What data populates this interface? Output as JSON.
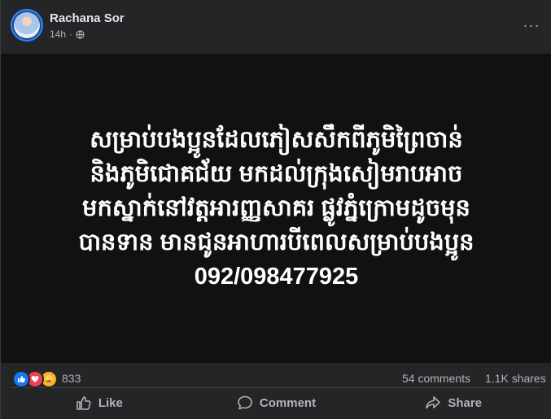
{
  "post": {
    "author": "Rachana Sor",
    "time": "14h",
    "separator": "·",
    "privacy_icon": "globe-icon",
    "more_icon": "more-options-icon",
    "more_glyph": "···",
    "text_lines": [
      "សម្រាប់បងប្អូនដែលភៀសសឹកពីភូមិព្រៃចាន់",
      "និងភូមិជោគជ័យ មកដល់ក្រុងសៀមរាបអាច",
      "មកស្នាក់នៅវត្តអារញ្ញសាគរ ផ្លូវភ្នំក្រោមដូចមុន",
      "បានទាន មានជូនអាហារបីពេលសម្រាប់បងប្អូន",
      "092/098477925"
    ],
    "background_color": "#111111"
  },
  "stats": {
    "reaction_icons": [
      "like-icon",
      "love-icon",
      "care-icon"
    ],
    "reaction_count": "833",
    "comments": "54 comments",
    "shares": "1.1K shares"
  },
  "actions": {
    "like": "Like",
    "comment": "Comment",
    "share": "Share"
  },
  "colors": {
    "card": "#242526",
    "text_primary": "#e4e6eb",
    "text_secondary": "#b0b3b8",
    "like_blue": "#1877f2",
    "love_red": "#f33e58",
    "care_yellow": "#f7b125"
  }
}
